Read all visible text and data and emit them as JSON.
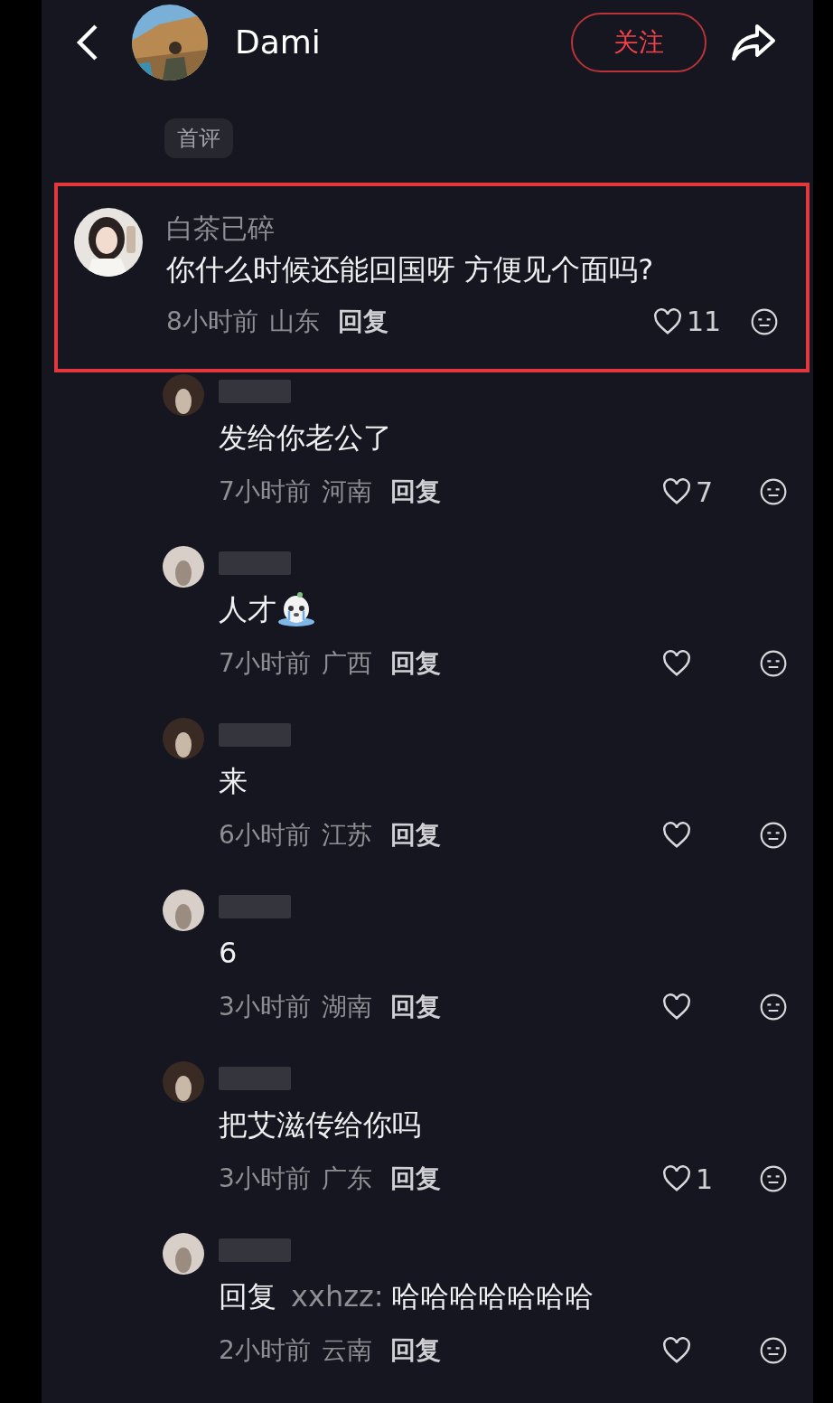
{
  "header": {
    "name": "Dami",
    "follow": "关注"
  },
  "first_badge": "首评",
  "highlighted": {
    "name": "白茶已碎",
    "text": "你什么时候还能回国呀 方便见个面吗?",
    "time": "8小时前",
    "location": "山东",
    "reply": "回复",
    "likes": "11"
  },
  "replies": [
    {
      "kind": "plain",
      "text": "发给你老公了",
      "time": "7小时前",
      "location": "河南",
      "reply": "回复",
      "likes": "7"
    },
    {
      "kind": "sticker",
      "text": "人才",
      "time": "7小时前",
      "location": "广西",
      "reply": "回复"
    },
    {
      "kind": "plain",
      "text": "来",
      "time": "6小时前",
      "location": "江苏",
      "reply": "回复"
    },
    {
      "kind": "plain",
      "text": "6",
      "time": "3小时前",
      "location": "湖南",
      "reply": "回复"
    },
    {
      "kind": "plain",
      "text": "把艾滋传给你吗",
      "time": "3小时前",
      "location": "广东",
      "reply": "回复",
      "likes": "1"
    },
    {
      "kind": "reply_to",
      "prefix": "回复",
      "target": "xxhzz:",
      "text": "哈哈哈哈哈哈哈",
      "time": "2小时前",
      "location": "云南",
      "reply": "回复"
    }
  ]
}
